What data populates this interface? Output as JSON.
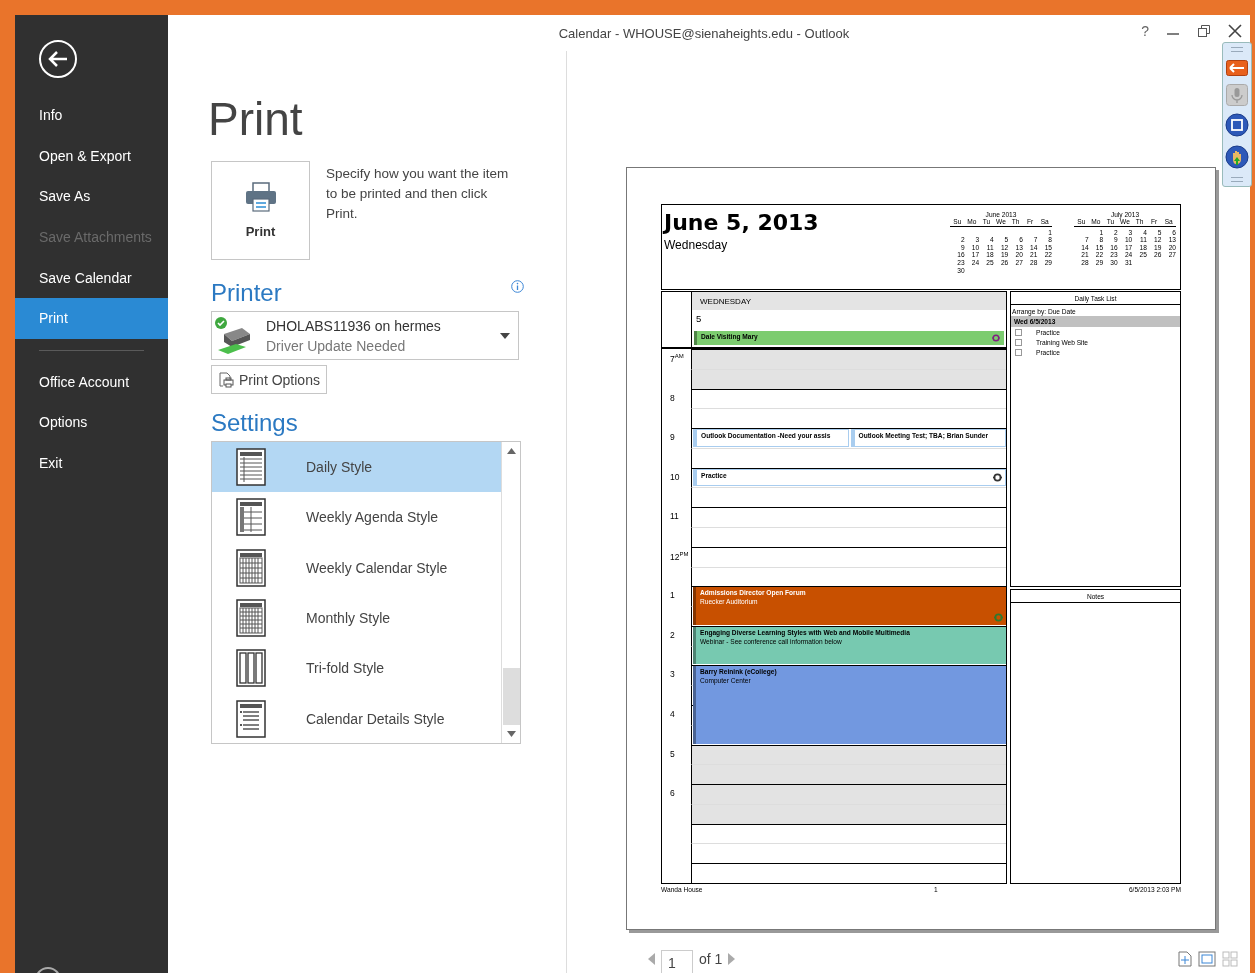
{
  "window": {
    "title": "Calendar - WHOUSE@sienaheights.edu - Outlook",
    "help": "?"
  },
  "sidebar": {
    "groups": [
      [
        {
          "label": "Info",
          "selected": false,
          "disabled": false
        },
        {
          "label": "Open & Export",
          "selected": false,
          "disabled": false
        },
        {
          "label": "Save As",
          "selected": false,
          "disabled": false
        },
        {
          "label": "Save Attachments",
          "selected": false,
          "disabled": true
        },
        {
          "label": "Save Calendar",
          "selected": false,
          "disabled": false
        },
        {
          "label": "Print",
          "selected": true,
          "disabled": false
        }
      ],
      [
        {
          "label": "Office Account",
          "selected": false,
          "disabled": false
        },
        {
          "label": "Options",
          "selected": false,
          "disabled": false
        },
        {
          "label": "Exit",
          "selected": false,
          "disabled": false
        }
      ]
    ]
  },
  "page_title": "Print",
  "print_button": {
    "label": "Print"
  },
  "description": "Specify how you want the item to be printed and then click Print.",
  "printer": {
    "heading": "Printer",
    "name": "DHOLABS11936 on hermes",
    "status": "Driver Update Needed",
    "options_button": "Print Options"
  },
  "settings": {
    "heading": "Settings",
    "styles": [
      {
        "label": "Daily Style",
        "kind": "daily",
        "selected": true
      },
      {
        "label": "Weekly Agenda Style",
        "kind": "agenda",
        "selected": false
      },
      {
        "label": "Weekly Calendar Style",
        "kind": "week",
        "selected": false
      },
      {
        "label": "Monthly Style",
        "kind": "month",
        "selected": false
      },
      {
        "label": "Tri-fold Style",
        "kind": "trifold",
        "selected": false
      },
      {
        "label": "Calendar Details Style",
        "kind": "details",
        "selected": false
      }
    ]
  },
  "preview": {
    "date_title": "June 5, 2013",
    "weekday": "Wednesday",
    "mini_calendars": [
      {
        "title": "June 2013",
        "weekdays": [
          "Su",
          "Mo",
          "Tu",
          "We",
          "Th",
          "Fr",
          "Sa"
        ],
        "weeks": [
          {
            "kind": "lead",
            "days": [
              "1"
            ]
          },
          {
            "kind": "full",
            "days": [
              "2",
              "3",
              "4",
              "5",
              "6",
              "7",
              "8"
            ]
          },
          {
            "kind": "full",
            "days": [
              "9",
              "10",
              "11",
              "12",
              "13",
              "14",
              "15"
            ]
          },
          {
            "kind": "full",
            "days": [
              "16",
              "17",
              "18",
              "19",
              "20",
              "21",
              "22"
            ]
          },
          {
            "kind": "full",
            "days": [
              "23",
              "24",
              "25",
              "26",
              "27",
              "28",
              "29"
            ]
          },
          {
            "kind": "full",
            "days": [
              "30"
            ]
          }
        ]
      },
      {
        "title": "July 2013",
        "weekdays": [
          "Su",
          "Mo",
          "Tu",
          "We",
          "Th",
          "Fr",
          "Sa"
        ],
        "weeks": [
          {
            "kind": "lead",
            "days": [
              "1",
              "2",
              "3",
              "4",
              "5",
              "6"
            ]
          },
          {
            "kind": "full",
            "days": [
              "7",
              "8",
              "9",
              "10",
              "11",
              "12",
              "13"
            ]
          },
          {
            "kind": "full",
            "days": [
              "14",
              "15",
              "16",
              "17",
              "18",
              "19",
              "20"
            ]
          },
          {
            "kind": "full",
            "days": [
              "21",
              "22",
              "23",
              "24",
              "25",
              "26",
              "27"
            ]
          },
          {
            "kind": "full",
            "days": [
              "28",
              "29",
              "30",
              "31"
            ]
          }
        ]
      }
    ],
    "day": {
      "header": "WEDNESDAY",
      "date": "5",
      "all_day": [
        {
          "title": "Dale Visiting Mary",
          "color": "#7ccc6f",
          "recurring": true
        }
      ],
      "slots": [
        {
          "label": "7",
          "suffix": "AM",
          "shaded": true
        },
        {
          "shaded": true
        },
        {
          "label": "8",
          "shaded": false
        },
        {
          "shaded": false
        },
        {
          "label": "9",
          "shaded": false,
          "events": [
            {
              "kind": "half_hour",
              "title": "Outlook Documentation -Need your assis",
              "color": "#ffffff",
              "recurring": false
            },
            {
              "kind": "half_hour",
              "title": "Outlook Meeting Test; TBA; Brian Sunder",
              "color": "#ffffff",
              "recurring": false
            }
          ]
        },
        {
          "shaded": false
        },
        {
          "label": "10",
          "shaded": false,
          "events": [
            {
              "kind": "half_hour",
              "title": "Practice",
              "color": "#ffffff",
              "recurring": true
            }
          ]
        },
        {
          "shaded": false
        },
        {
          "label": "11",
          "shaded": false
        },
        {
          "shaded": false
        },
        {
          "label": "12",
          "suffix": "PM",
          "shaded": false
        },
        {
          "shaded": false
        },
        {
          "label": "1",
          "shaded": false,
          "events": [
            {
              "kind": "hour",
              "title": "Admissions Director Open Forum",
              "location": "Ruecker Auditorium",
              "color": "#c85000",
              "recurring": true
            }
          ]
        },
        {
          "shaded": false
        },
        {
          "label": "2",
          "shaded": false,
          "events": [
            {
              "kind": "hour",
              "title": "Engaging Diverse Learning Styles with Web and Mobile Multimedia",
              "location": "Webinar - See conference call information below",
              "color": "#77c9b0",
              "recurring": false
            }
          ]
        },
        {
          "shaded": false
        },
        {
          "label": "3",
          "shaded": false,
          "events": [
            {
              "kind": "two_hours",
              "title": "Barry Reinink (eCollege)",
              "location": "Computer Center",
              "color": "#7298e0",
              "recurring": false
            }
          ]
        },
        {
          "shaded": false
        },
        {
          "label": "4",
          "shaded": false
        },
        {
          "shaded": false
        },
        {
          "label": "5",
          "shaded": true
        },
        {
          "shaded": true
        },
        {
          "label": "6",
          "shaded": true
        },
        {
          "shaded": true
        },
        {
          "shaded": false
        },
        {
          "shaded": false
        },
        {
          "shaded": false
        }
      ]
    },
    "tasks": {
      "title": "Daily Task List",
      "arrange": "Arrange by: Due Date",
      "group": "Wed 6/5/2013",
      "items": [
        {
          "title": "Practice",
          "checked": false
        },
        {
          "title": "Training Web Site",
          "checked": false
        },
        {
          "title": "Practice",
          "checked": false
        }
      ]
    },
    "notes": {
      "title": "Notes"
    },
    "footer": {
      "owner": "Wanda House",
      "page": "1",
      "printed": "6/5/2013 2:03 PM"
    }
  },
  "pager": {
    "page": "1",
    "of": "of 1"
  }
}
